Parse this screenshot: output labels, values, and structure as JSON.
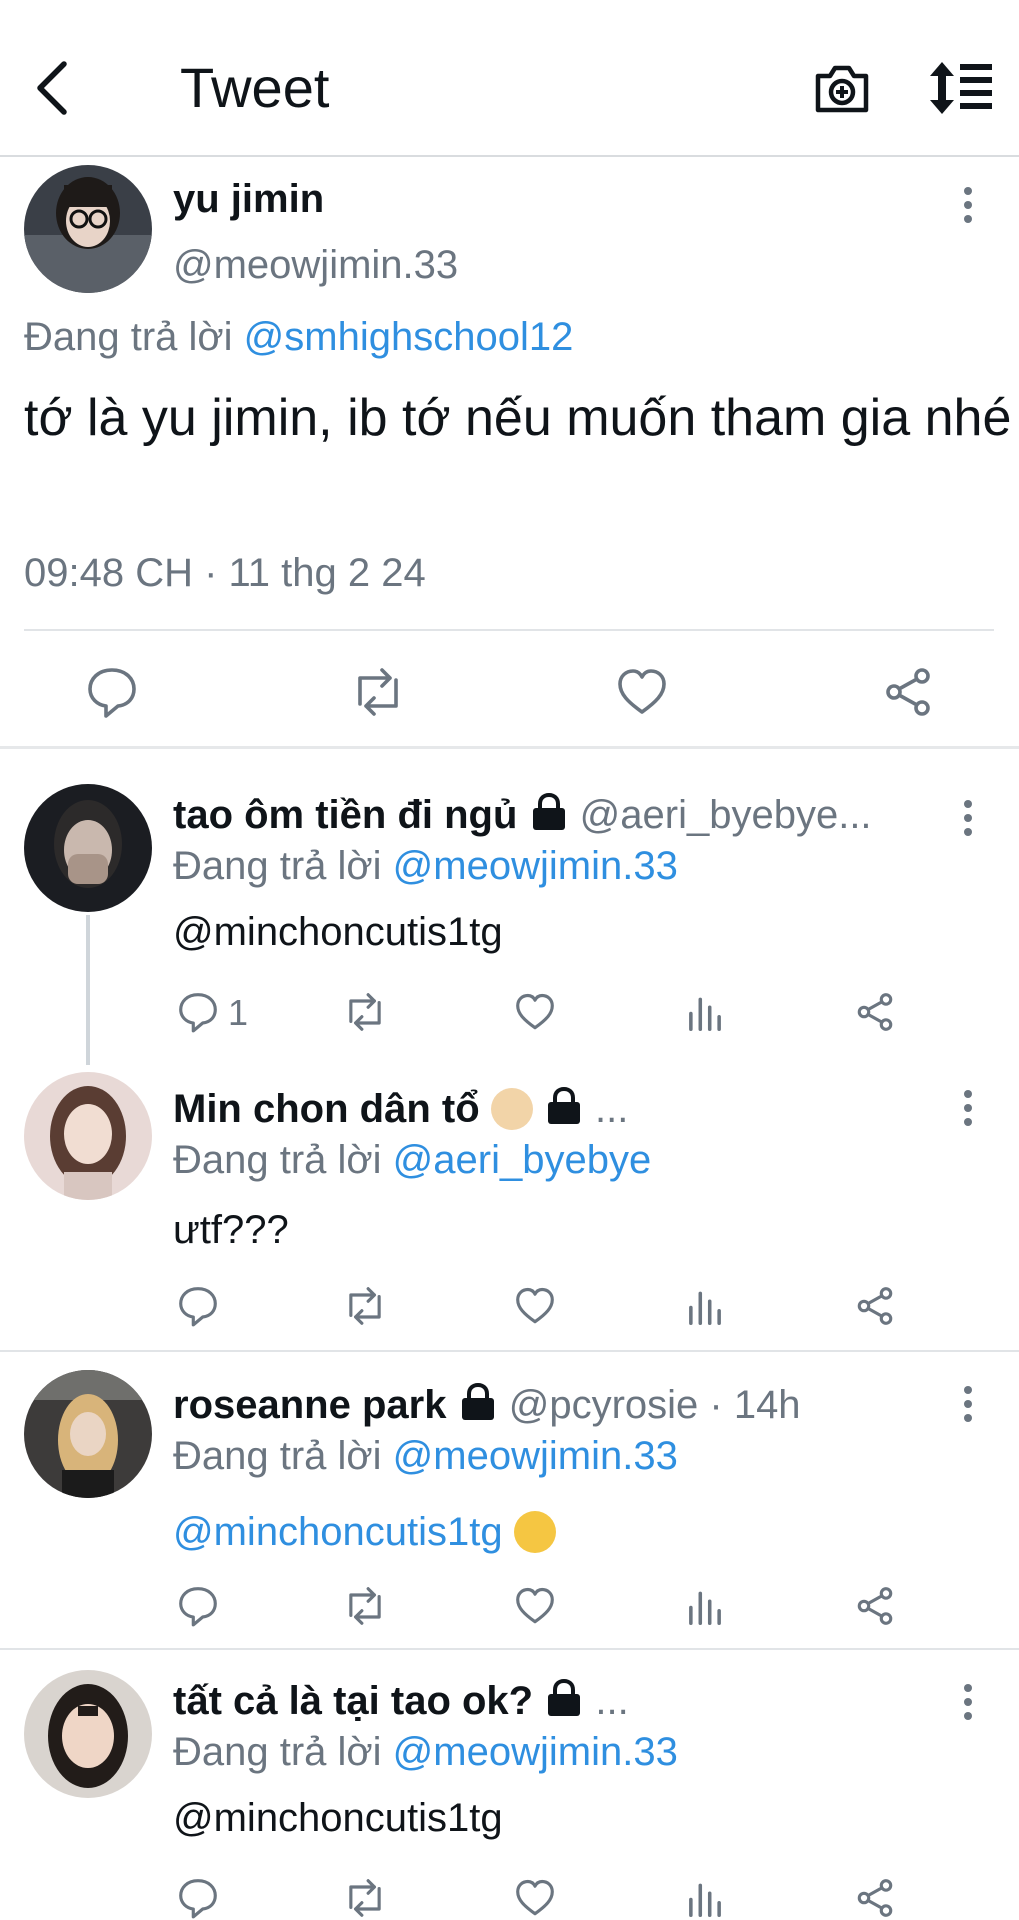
{
  "header": {
    "title": "Tweet",
    "back_icon": "back-arrow-icon",
    "camera_icon": "camera-plus-icon",
    "sort_icon": "sort-icon"
  },
  "main_tweet": {
    "name": "yu jimin",
    "handle": "@meowjimin.33",
    "reply_prefix": "Đang trả lời",
    "reply_mention": "@smhighschool12",
    "text": "tớ là yu jimin, ib tớ nếu muốn tham gia nhé",
    "timestamp": "09:48 CH · 11 thg 2 24"
  },
  "replies": [
    {
      "name": "tao ôm tiền đi ngủ",
      "handle": "@aeri_byebye...",
      "reply_prefix": "Đang trả lời",
      "reply_mention": "@meowjimin.33",
      "body": "@minchoncutis1tg",
      "reply_count": "1"
    },
    {
      "name": "Min chon dân tổ",
      "handle": "...",
      "reply_prefix": "Đang trả lời",
      "reply_mention": "@aeri_byebye",
      "body": "ưtf???"
    },
    {
      "name": "roseanne park",
      "handle": "@pcyrosie · 14h",
      "reply_prefix": "Đang trả lời",
      "reply_mention": "@meowjimin.33",
      "body": "@minchoncutis1tg"
    },
    {
      "name": "tất cả là tại tao ok?",
      "handle": "...",
      "reply_prefix": "Đang trả lời",
      "reply_mention": "@meowjimin.33",
      "body": "@minchoncutis1tg"
    }
  ],
  "colors": {
    "mention": "#2f8fe0",
    "secondary_text": "#6b7580",
    "icon": "#6b7580"
  }
}
